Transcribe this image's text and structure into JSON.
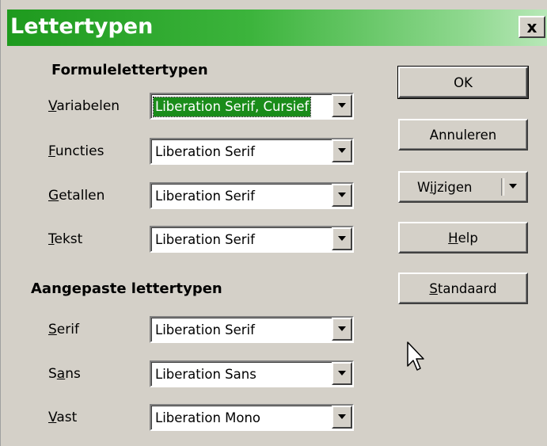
{
  "window": {
    "title": "Lettertypen",
    "close_glyph": "x",
    "title_gradient": [
      "#1e9a1e",
      "#b8e8b8"
    ]
  },
  "formula_fonts": {
    "heading": "Formulelettertypen",
    "rows": [
      {
        "label_mnemonic": "V",
        "label_rest": "ariabelen",
        "value": "Liberation Serif, Cursief",
        "selected": true
      },
      {
        "label_mnemonic": "F",
        "label_rest": "uncties",
        "value": "Liberation Serif"
      },
      {
        "label_mnemonic": "G",
        "label_rest": "etallen",
        "value": "Liberation Serif"
      },
      {
        "label_mnemonic": "T",
        "label_rest": "ekst",
        "value": "Liberation Serif"
      }
    ]
  },
  "custom_fonts": {
    "heading": "Aangepaste lettertypen",
    "rows": [
      {
        "label_mnemonic": "S",
        "label_rest": "erif",
        "value": "Liberation Serif"
      },
      {
        "label_pre": "S",
        "label_mnemonic": "a",
        "label_rest": "ns",
        "value": "Liberation Sans"
      },
      {
        "label_mnemonic": "V",
        "label_rest": "ast",
        "value": "Liberation Mono"
      }
    ]
  },
  "buttons": {
    "ok": "OK",
    "cancel": "Annuleren",
    "modify_pre": "W",
    "modify_mnemonic": "i",
    "modify_rest": "jzigen",
    "help_mnemonic": "H",
    "help_rest": "elp",
    "default_mnemonic": "S",
    "default_rest": "tandaard"
  },
  "colors": {
    "selection": "#1a8c1a",
    "dialog_bg": "#d4d0c8"
  },
  "icons": {
    "close": "close-icon",
    "dropdown": "chevron-down-icon",
    "cursor": "mouse-pointer-icon"
  }
}
